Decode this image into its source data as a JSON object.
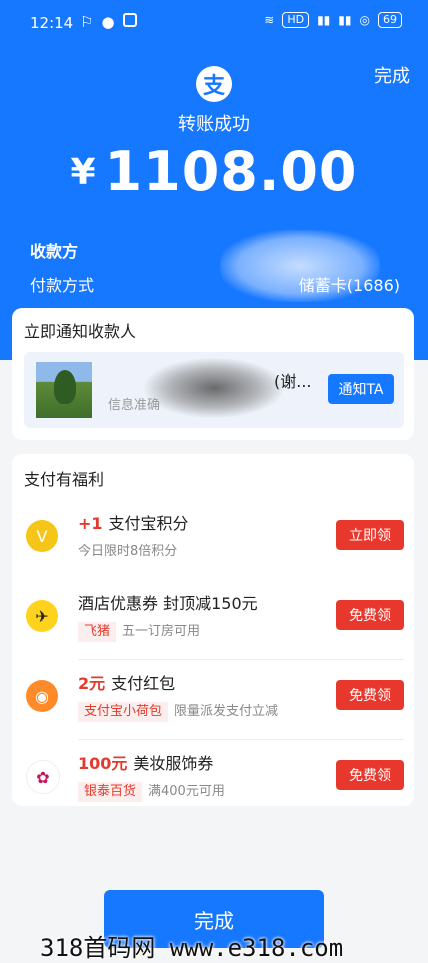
{
  "status_bar": {
    "time": "12:14",
    "battery": "69",
    "hd": "HD"
  },
  "header": {
    "done": "完成",
    "logo_glyph": "支",
    "success": "转账成功",
    "currency": "¥",
    "amount": "1108.00"
  },
  "details": {
    "payee_label": "收款方",
    "method_label": "付款方式",
    "method_value": "储蓄卡(1686)"
  },
  "notify": {
    "title": "立即通知收款人",
    "name": "(谢...",
    "subtitle": "信息准确",
    "button": "通知TA"
  },
  "benefits": {
    "title": "支付有福利",
    "items": [
      {
        "highlight": "+1",
        "title": "支付宝积分",
        "tag": "",
        "desc": "今日限时8倍积分",
        "button": "立即领",
        "icon": "points-coin-icon",
        "icon_color": "#f5c518"
      },
      {
        "highlight": "",
        "title": "酒店优惠券 封顶减150元",
        "tag": "飞猪",
        "desc": "五一订房可用",
        "button": "免费领",
        "icon": "fliggy-icon",
        "icon_color": "#ffd21e"
      },
      {
        "highlight": "2元",
        "title": "支付红包",
        "tag": "支付宝小荷包",
        "desc": "限量派发支付立减",
        "button": "免费领",
        "icon": "red-packet-icon",
        "icon_color": "#ff8a2a"
      },
      {
        "highlight": "100元",
        "title": "美妆服饰券",
        "tag": "银泰百货",
        "desc": "满400元可用",
        "button": "免费领",
        "icon": "intime-logo-icon",
        "icon_color": "#c2185b"
      }
    ]
  },
  "footer": {
    "done": "完成"
  },
  "watermark": "318首码网  www.e318.com"
}
